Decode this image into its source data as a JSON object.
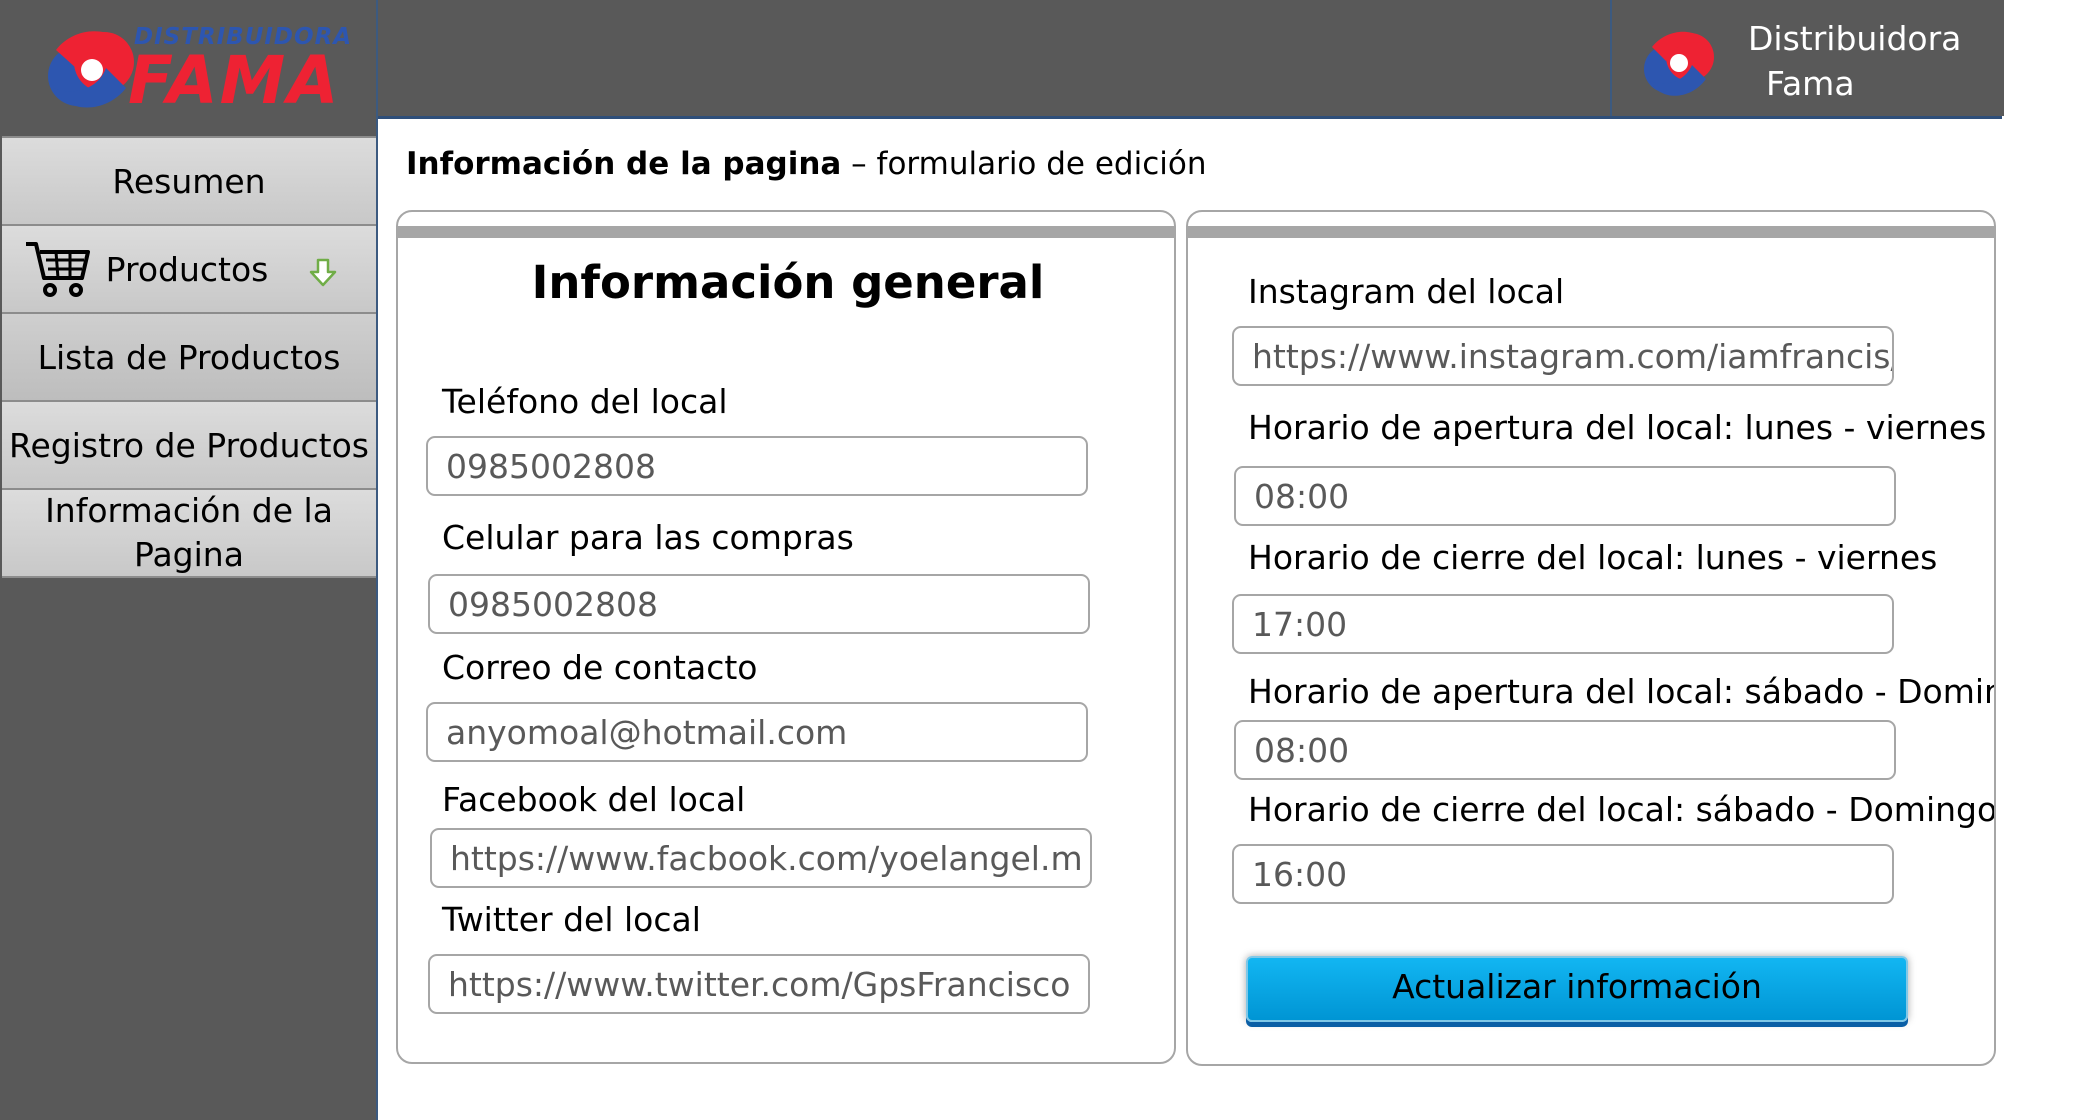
{
  "brand": {
    "logo_top": "DISTRIBUIDORA",
    "logo_main": "FAMA",
    "name_line1": "Distribuidora",
    "name_line2": "Fama"
  },
  "sidebar": {
    "items": [
      {
        "label": "Resumen"
      },
      {
        "label": "Productos",
        "icon": "cart-icon",
        "indicator": "arrow-down-icon"
      },
      {
        "label": "Lista de Productos"
      },
      {
        "label": "Registro de Productos"
      },
      {
        "label_line1": "Información de la",
        "label_line2": "Pagina"
      }
    ]
  },
  "page": {
    "title_bold": "Información de la pagina",
    "title_rest": " – formulario de edición"
  },
  "general": {
    "title": "Información general",
    "fields": [
      {
        "label": "Teléfono del local",
        "value": "0985002808"
      },
      {
        "label": "Celular para las compras",
        "value": "0985002808"
      },
      {
        "label": "Correo de contacto",
        "value": "anyomoal@hotmail.com"
      },
      {
        "label": "Facebook del local",
        "value": "https://www.facbook.com/yoelangel.m"
      },
      {
        "label": "Twitter del local",
        "value": "https://www.twitter.com/GpsFrancisco"
      }
    ]
  },
  "social": {
    "fields": [
      {
        "label": "Instagram del local",
        "value": "https://www.instagram.com/iamfrancis/"
      },
      {
        "label": "Horario de apertura del local: lunes - viernes",
        "value": "08:00"
      },
      {
        "label": "Horario de cierre del local: lunes - viernes",
        "value": "17:00"
      },
      {
        "label": "Horario de apertura del local: sábado - Domingo",
        "value": "08:00"
      },
      {
        "label": "Horario de cierre del local: sábado - Domingo",
        "value": "16:00"
      }
    ],
    "button": "Actualizar información"
  },
  "colors": {
    "topbar": "#595959",
    "sidebar_item": "#d0d0d0",
    "button": "#00a2e8",
    "logo_red": "#ee2233",
    "logo_blue": "#2d56b0"
  }
}
